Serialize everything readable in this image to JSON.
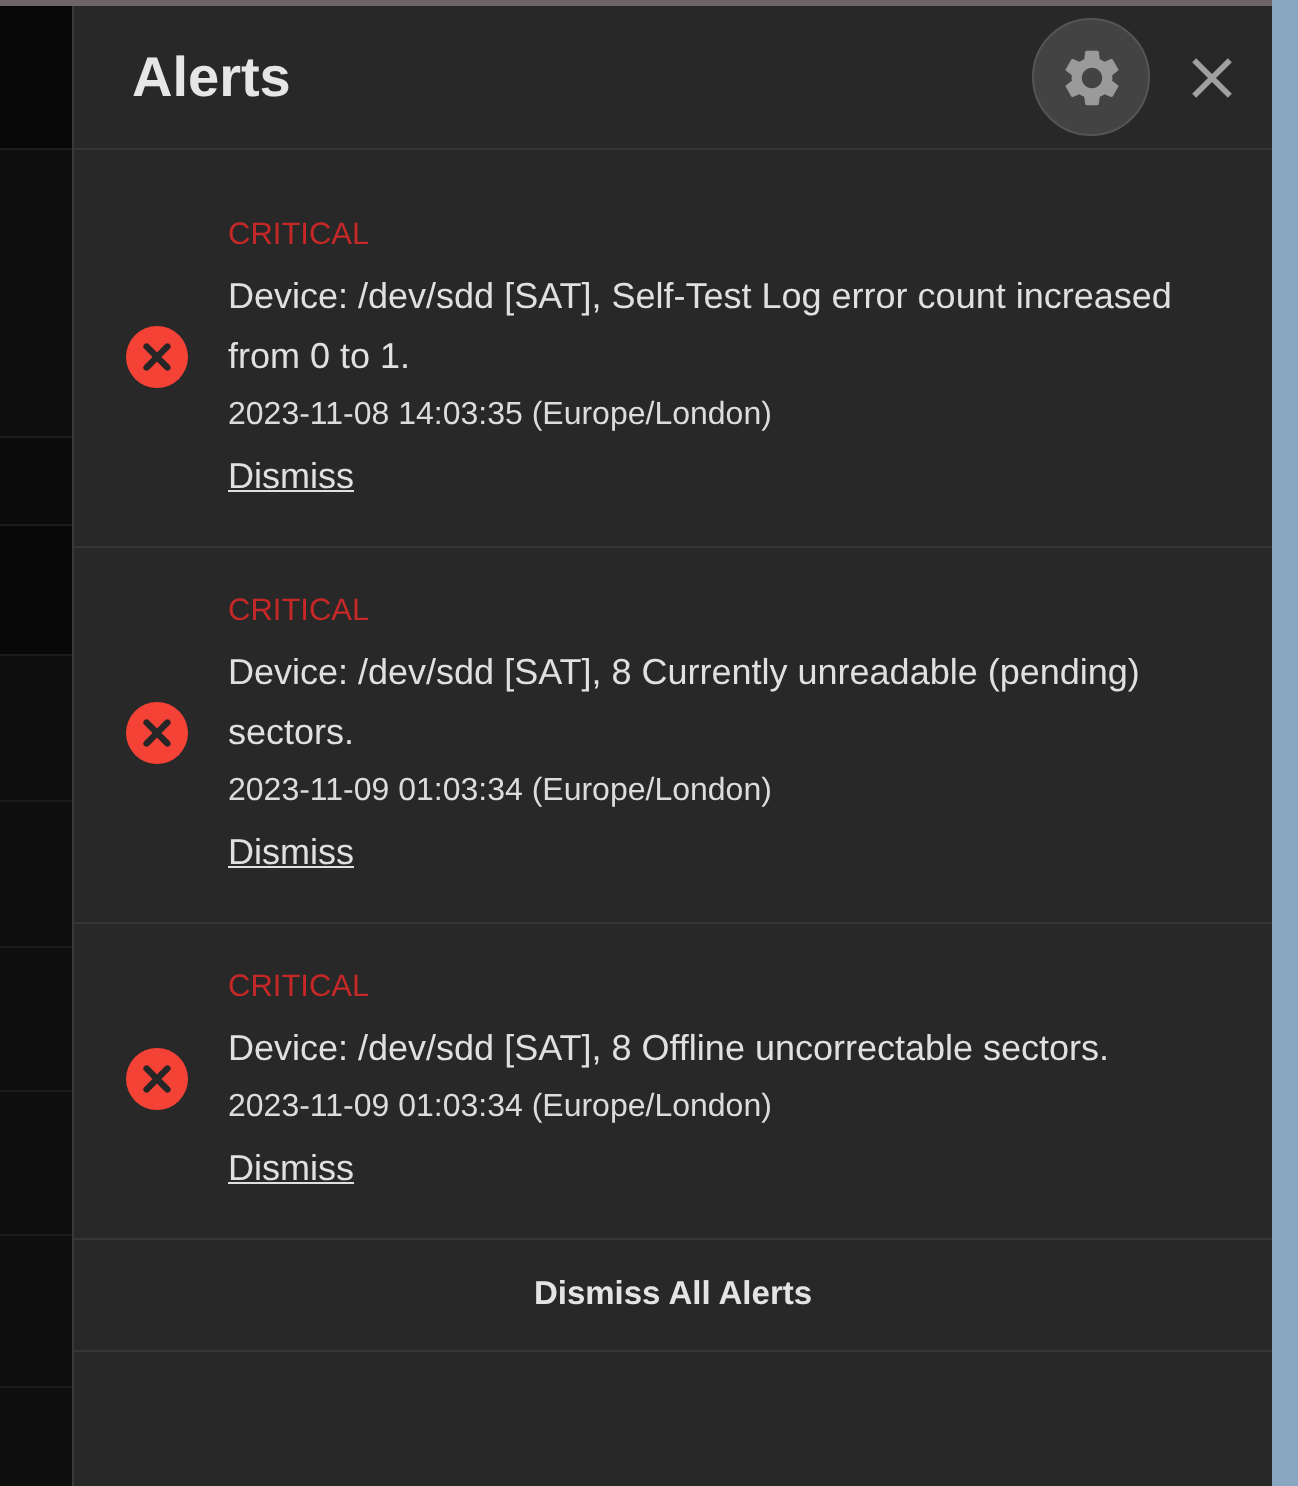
{
  "header": {
    "title": "Alerts"
  },
  "alerts": [
    {
      "kind": "error",
      "severity": "CRITICAL",
      "message": "Device: /dev/sdd [SAT], Self-Test Log error count increased from 0 to 1.",
      "timestamp": "2023-11-08 14:03:35 (Europe/London)",
      "action": "Dismiss"
    },
    {
      "kind": "error",
      "severity": "CRITICAL",
      "message": "Device: /dev/sdd [SAT], 8 Currently unreadable (pending) sectors.",
      "timestamp": "2023-11-09 01:03:34 (Europe/London)",
      "action": "Dismiss"
    },
    {
      "kind": "error",
      "severity": "CRITICAL",
      "message": "Device: /dev/sdd [SAT], 8 Offline uncorrectable sectors.",
      "timestamp": "2023-11-09 01:03:34 (Europe/London)",
      "action": "Dismiss"
    }
  ],
  "footer": {
    "action": "Dismiss All Alerts"
  }
}
